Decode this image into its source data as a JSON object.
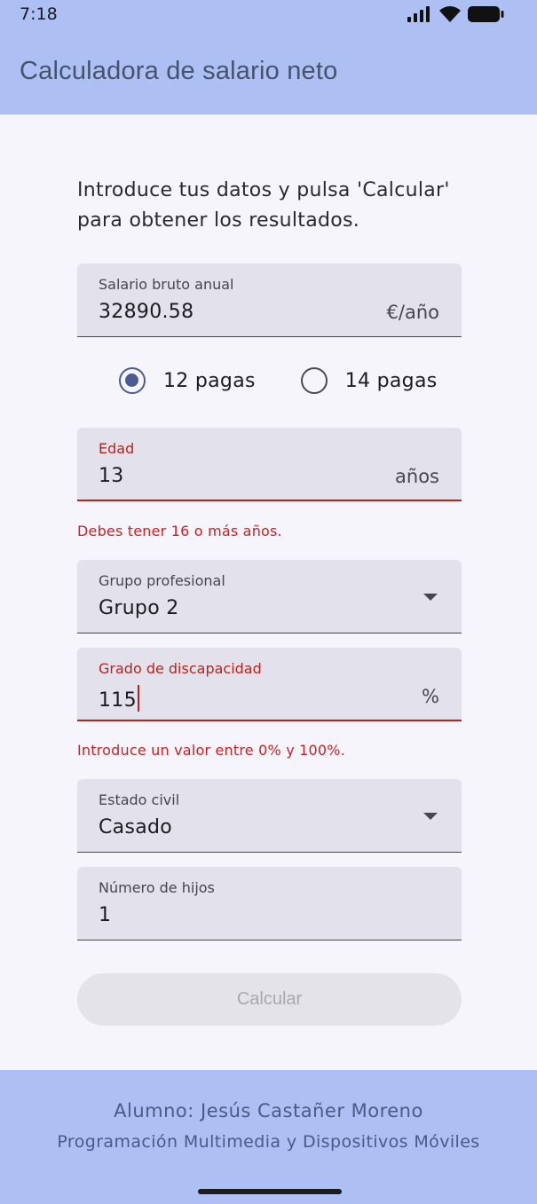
{
  "status_bar": {
    "time": "7:18"
  },
  "app_bar": {
    "title": "Calculadora de salario neto"
  },
  "intro_text": "Introduce tus datos y pulsa 'Calcular' para obtener los resultados.",
  "salary": {
    "label": "Salario bruto anual",
    "value": "32890.58",
    "suffix": "€/año"
  },
  "payments": {
    "options": [
      {
        "label": "12 pagas",
        "selected": true
      },
      {
        "label": "14 pagas",
        "selected": false
      }
    ]
  },
  "age": {
    "label": "Edad",
    "value": "13",
    "suffix": "años",
    "error": "Debes tener 16 o más años."
  },
  "professional_group": {
    "label": "Grupo profesional",
    "value": "Grupo 2"
  },
  "disability": {
    "label": "Grado de discapacidad",
    "value": "115",
    "suffix": "%",
    "error": "Introduce un valor entre 0% y 100%."
  },
  "civil_status": {
    "label": "Estado civil",
    "value": "Casado"
  },
  "children": {
    "label": "Número de hijos",
    "value": "1"
  },
  "calculate_button": {
    "label": "Calcular",
    "enabled": false
  },
  "footer": {
    "student": "Alumno: Jesús Castañer Moreno",
    "course": "Programación Multimedia y Dispositivos Móviles"
  },
  "colors": {
    "primary_container": "#aec0f3",
    "primary": "#4c5c92",
    "error": "#b3261e",
    "field_background": "#e2e1ec",
    "background": "#f7f5fc"
  }
}
